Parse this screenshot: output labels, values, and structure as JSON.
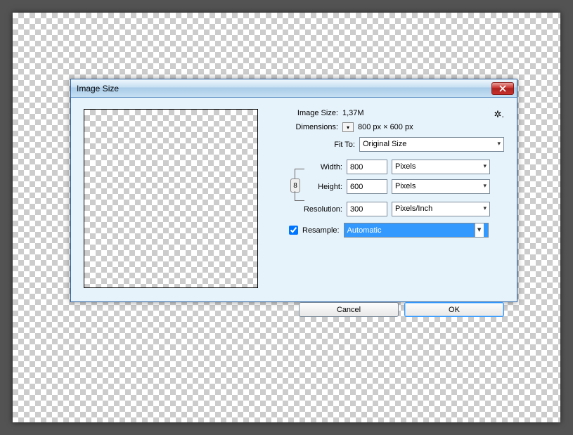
{
  "dialog": {
    "title": "Image Size",
    "imageSizeLabel": "Image Size:",
    "imageSizeValue": "1,37M",
    "dimensionsLabel": "Dimensions:",
    "dimensionsValue": "800 px  ×  600 px",
    "fitToLabel": "Fit To:",
    "fitToValue": "Original Size",
    "widthLabel": "Width:",
    "widthValue": "800",
    "widthUnit": "Pixels",
    "heightLabel": "Height:",
    "heightValue": "600",
    "heightUnit": "Pixels",
    "resolutionLabel": "Resolution:",
    "resolutionValue": "300",
    "resolutionUnit": "Pixels/Inch",
    "resampleLabel": "Resample:",
    "resampleChecked": true,
    "resampleMethod": "Automatic",
    "cancelLabel": "Cancel",
    "okLabel": "OK"
  }
}
